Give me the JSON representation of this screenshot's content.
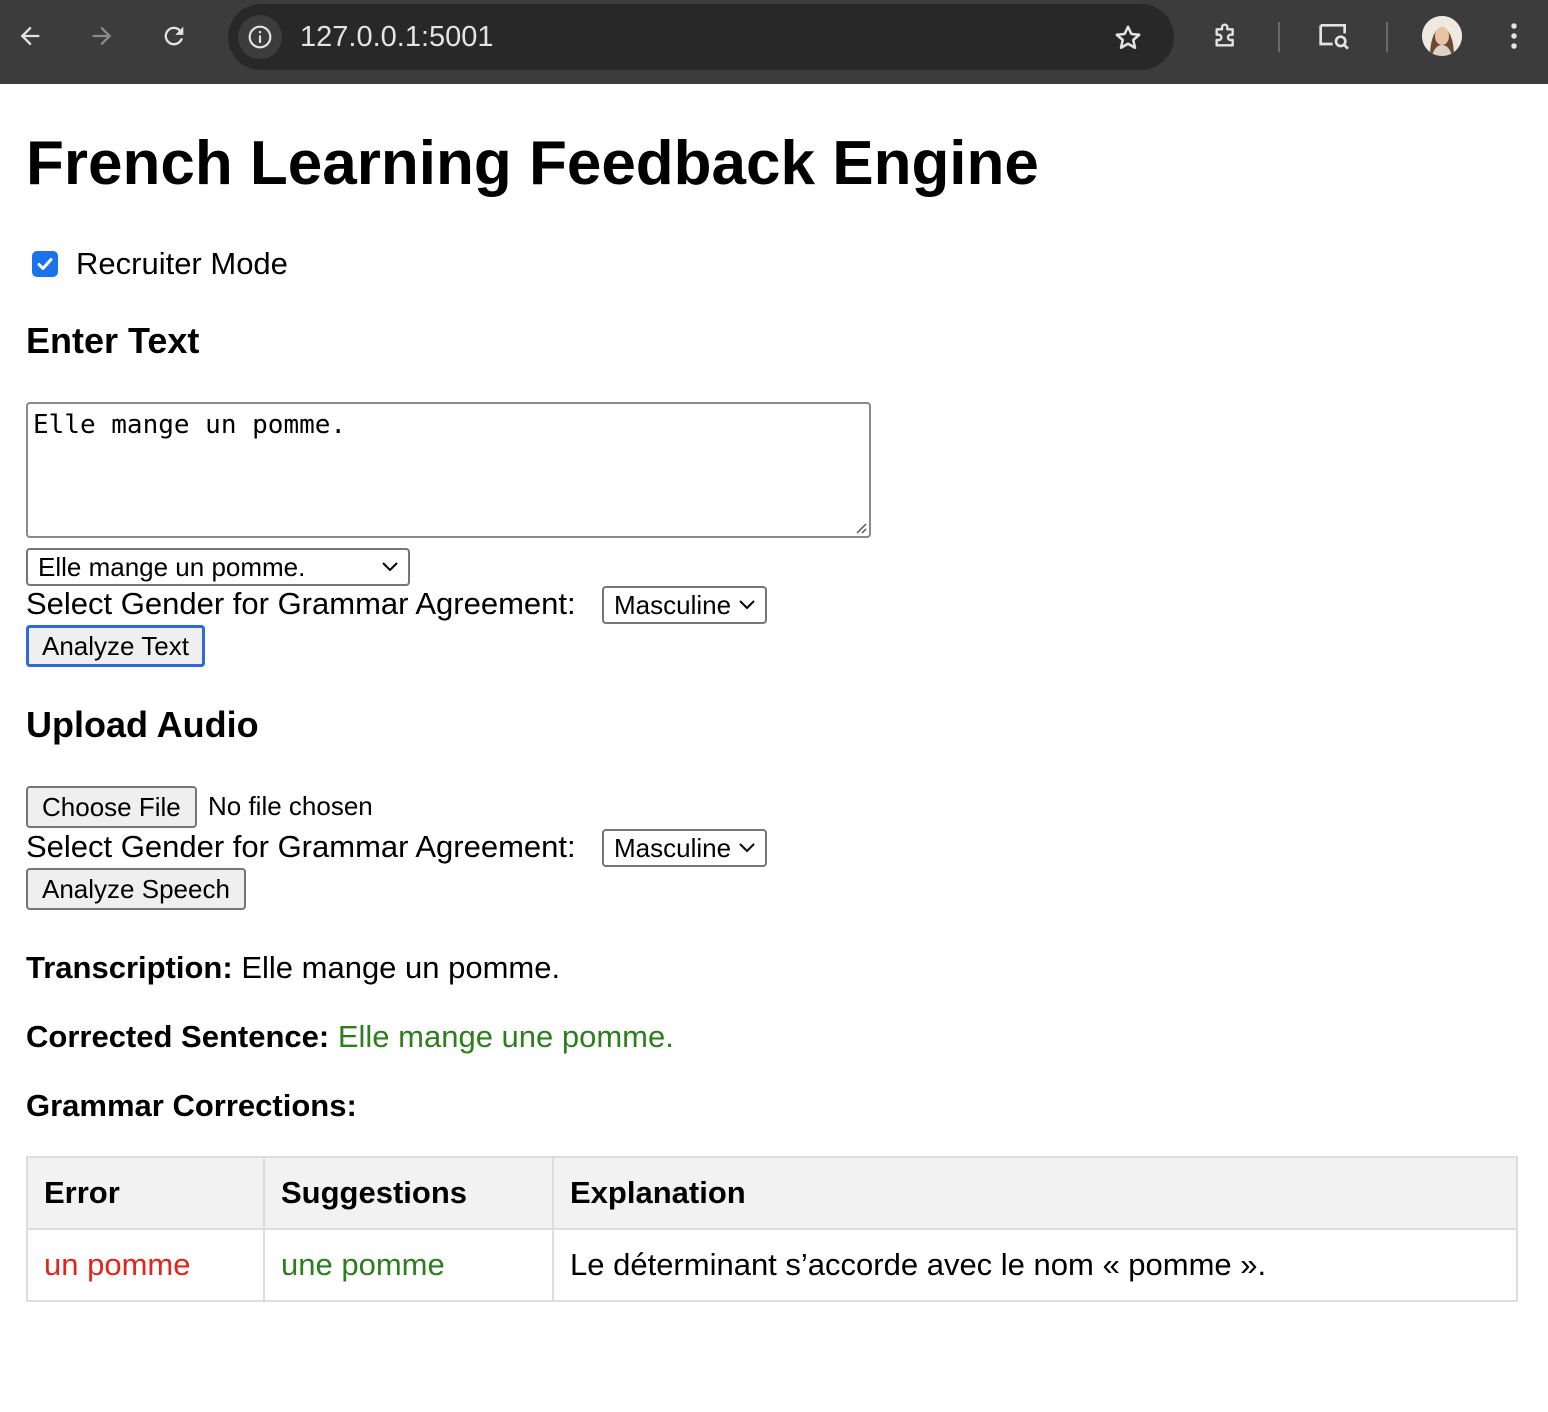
{
  "browser": {
    "url": "127.0.0.1:5001"
  },
  "page": {
    "title": "French Learning Feedback Engine",
    "recruiter_mode": {
      "label": "Recruiter Mode",
      "checked": true
    },
    "text_section": {
      "heading": "Enter Text",
      "textarea_value": "Elle mange un pomme.",
      "sample_select_value": "Elle mange un pomme.",
      "gender_label": "Select Gender for Grammar Agreement:",
      "gender_value": "Masculine",
      "analyze_label": "Analyze Text"
    },
    "audio_section": {
      "heading": "Upload Audio",
      "choose_file_label": "Choose File",
      "file_status": "No file chosen",
      "gender_label": "Select Gender for Grammar Agreement:",
      "gender_value": "Masculine",
      "analyze_label": "Analyze Speech"
    },
    "results": {
      "transcription_label": "Transcription:",
      "transcription_value": "Elle mange un pomme.",
      "corrected_label": "Corrected Sentence:",
      "corrected_value": "Elle mange une pomme.",
      "corrections_label": "Grammar Corrections:",
      "table": {
        "headers": [
          "Error",
          "Suggestions",
          "Explanation"
        ],
        "rows": [
          {
            "error": "un pomme",
            "suggestion": "une pomme",
            "explanation": "Le déterminant s’accorde avec le nom « pomme »."
          }
        ]
      }
    }
  },
  "colors": {
    "accent": "#1a73e8",
    "correct": "#2e7d1e",
    "error": "#e3241a"
  }
}
